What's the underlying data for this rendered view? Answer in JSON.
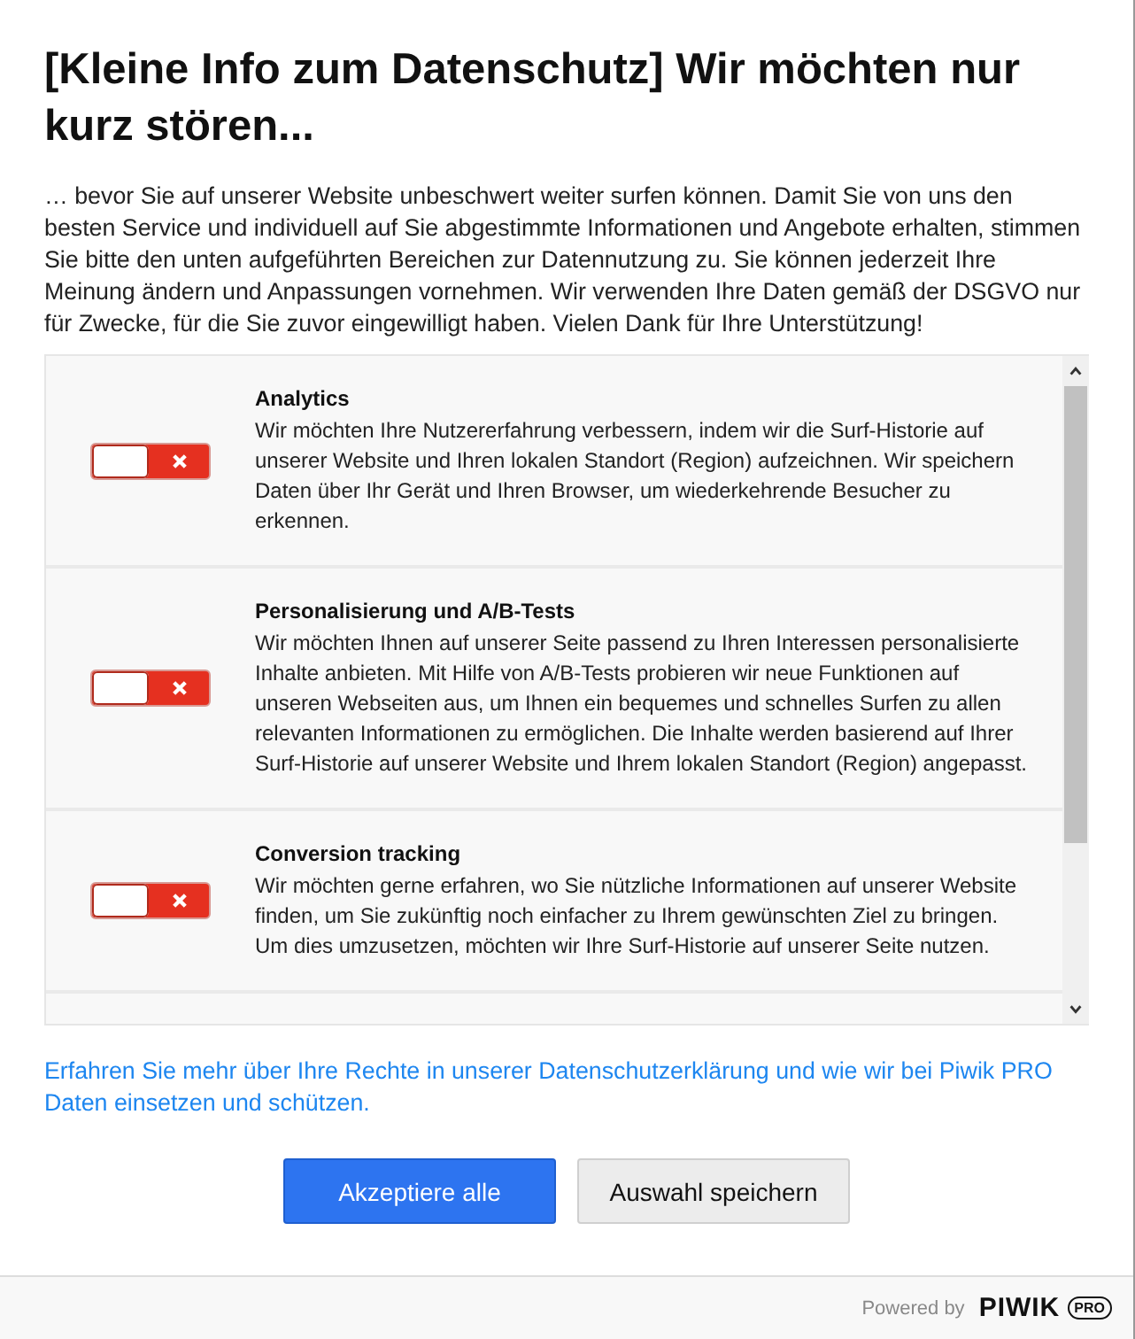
{
  "title": "[Kleine Info zum Datenschutz] Wir möchten nur kurz stören...",
  "intro": "… bevor Sie auf unserer Website unbeschwert weiter surfen können. Damit Sie von uns den besten Service und individuell auf Sie abgestimmte Informationen und Angebote erhalten, stimmen Sie bitte den unten aufgeführten Bereichen zur Datennutzung zu. Sie können jederzeit Ihre Meinung ändern und Anpassungen vornehmen. Wir verwenden Ihre Daten gemäß der DSGVO nur für Zwecke, für die Sie zuvor eingewilligt haben. Vielen Dank für Ihre Unterstützung!",
  "consents": [
    {
      "name": "Analytics",
      "description": "Wir möchten Ihre Nutzererfahrung verbessern, indem wir die Surf-Historie auf unserer Website und Ihren lokalen Standort (Region) aufzeichnen. Wir speichern Daten über Ihr Gerät und Ihren Browser, um wiederkehrende Besucher zu erkennen.",
      "checked": false
    },
    {
      "name": "Personalisierung und A/B-Tests",
      "description": "Wir möchten Ihnen auf unserer Seite passend zu Ihren Interessen personalisierte Inhalte anbieten. Mit Hilfe von A/B-Tests probieren wir neue Funktionen auf unseren Webseiten aus, um Ihnen ein bequemes und schnelles Surfen zu allen relevanten Informationen zu ermöglichen. Die Inhalte werden basierend auf Ihrer Surf-Historie auf unserer Website und Ihrem lokalen Standort (Region) angepasst.",
      "checked": false
    },
    {
      "name": "Conversion tracking",
      "description": "Wir möchten gerne erfahren, wo Sie nützliche Informationen auf unserer Website finden, um Sie zukünftig noch einfacher zu Ihrem gewünschten Ziel zu bringen. Um dies umzusetzen, möchten wir Ihre Surf-Historie auf unserer Seite nutzen.",
      "checked": false
    }
  ],
  "privacy_link": "Erfahren Sie mehr über Ihre Rechte in unserer Datenschutzerklärung und wie wir bei Piwik PRO Daten einsetzen und schützen.",
  "buttons": [
    {
      "label": "Akzeptiere alle",
      "kind": "primary"
    },
    {
      "label": "Auswahl speichern",
      "kind": "secondary"
    }
  ],
  "footer": {
    "powered_by": "Powered by",
    "logo": "PIWIK",
    "logo_badge": "PRO"
  }
}
